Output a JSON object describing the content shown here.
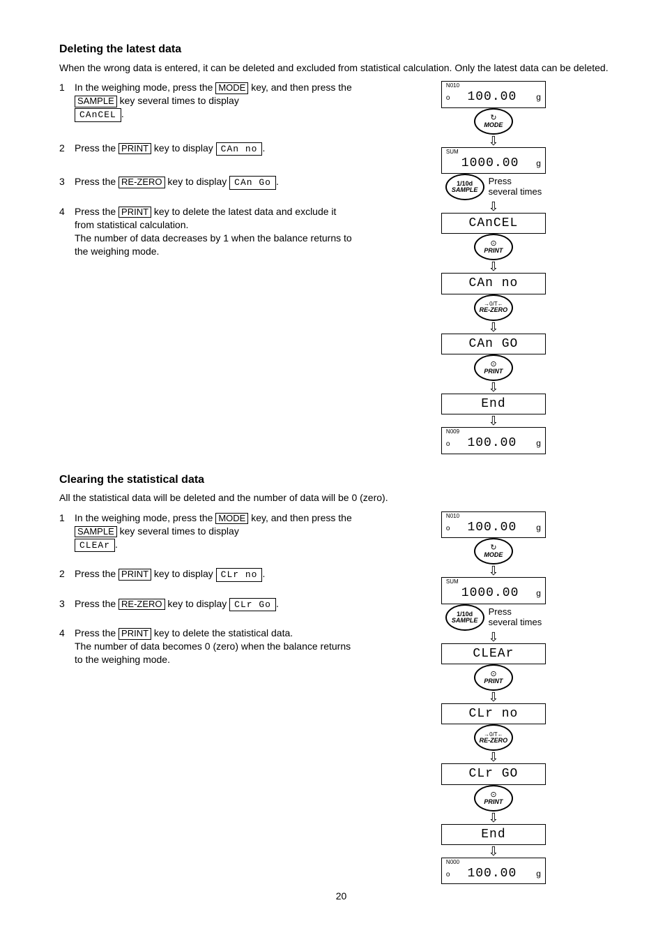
{
  "section1": {
    "heading": "Deleting the latest data",
    "intro": "When the wrong data is entered, it can be deleted and excluded from statistical calculation. Only the latest data can be deleted.",
    "steps": [
      {
        "num": "1",
        "t1": "In the weighing mode, press the ",
        "k1": "MODE",
        "t2": " key, and then press the ",
        "k2": "SAMPLE",
        "t3": " key several times to display ",
        "d1": "CAnCEL",
        "t4": "."
      },
      {
        "num": "2",
        "t1": "Press the ",
        "k1": "PRINT",
        "t2": " key to display ",
        "d1": "CAn no",
        "t3": "."
      },
      {
        "num": "3",
        "t1": "Press the ",
        "k1": "RE-ZERO",
        "t2": " key to display ",
        "d1": "CAn Go",
        "t3": "."
      },
      {
        "num": "4",
        "t1": "Press the ",
        "k1": "PRINT",
        "t2": " key to delete the latest data and exclude it from statistical calculation.",
        "t3": "The number of data decreases by 1 when the balance returns to the weighing mode."
      }
    ]
  },
  "section2": {
    "heading": "Clearing the statistical data",
    "intro": "All the statistical data will be deleted and the number of data will be 0 (zero).",
    "steps": [
      {
        "num": "1",
        "t1": "In the weighing mode, press the ",
        "k1": "MODE",
        "t2": " key, and then press the ",
        "k2": "SAMPLE",
        "t3": " key several times to display ",
        "d1": "CLEAr",
        "t4": "."
      },
      {
        "num": "2",
        "t1": "Press the ",
        "k1": "PRINT",
        "t2": " key to display ",
        "d1": "CLr no",
        "t3": "."
      },
      {
        "num": "3",
        "t1": "Press the ",
        "k1": "RE-ZERO",
        "t2": " key to display ",
        "d1": "CLr Go",
        "t3": "."
      },
      {
        "num": "4",
        "t1": "Press the ",
        "k1": "PRINT",
        "t2": " key to delete the statistical data.",
        "t3": "The number of data becomes 0 (zero) when the balance returns to the weighing mode."
      }
    ]
  },
  "fig1": {
    "lcd_n010_tag": "N010",
    "lcd_val_100": "100.00",
    "lcd_unit_g": "g",
    "btn_mode_sym": "↻",
    "btn_mode": "MODE",
    "lcd_sum_tag": "SUM",
    "lcd_val_1000": "1000.00",
    "btn_sample_top": "1/10d",
    "btn_sample": "SAMPLE",
    "annot_press": "Press",
    "annot_several": "several times",
    "lcd_cancel": "CAnCEL",
    "btn_print_sym": "⊙",
    "btn_print": "PRINT",
    "lcd_can_no": "CAn no",
    "btn_rezero_sym": "→0/T←",
    "btn_rezero": "RE-ZERO",
    "lcd_can_go": "CAn GO",
    "lcd_end": "End",
    "lcd_n009_tag": "N009"
  },
  "fig2": {
    "lcd_n010_tag": "N010",
    "lcd_val_100": "100.00",
    "lcd_unit_g": "g",
    "btn_mode_sym": "↻",
    "btn_mode": "MODE",
    "lcd_sum_tag": "SUM",
    "lcd_val_1000": "1000.00",
    "btn_sample_top": "1/10d",
    "btn_sample": "SAMPLE",
    "annot_press": "Press",
    "annot_several": "several times",
    "lcd_clear": "CLEAr",
    "btn_print_sym": "⊙",
    "btn_print": "PRINT",
    "lcd_clr_no": "CLr no",
    "btn_rezero_sym": "→0/T←",
    "btn_rezero": "RE-ZERO",
    "lcd_clr_go": "CLr GO",
    "lcd_end": "End",
    "lcd_n000_tag": "N000"
  },
  "page_number": "20"
}
